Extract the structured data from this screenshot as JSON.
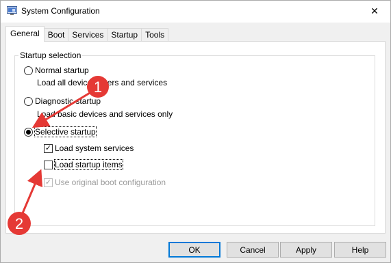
{
  "window": {
    "title": "System Configuration",
    "close_symbol": "✕"
  },
  "tabs": [
    {
      "label": "General",
      "active": true
    },
    {
      "label": "Boot",
      "active": false
    },
    {
      "label": "Services",
      "active": false
    },
    {
      "label": "Startup",
      "active": false
    },
    {
      "label": "Tools",
      "active": false
    }
  ],
  "startup_selection": {
    "legend": "Startup selection",
    "normal": {
      "label": "Normal startup",
      "description": "Load all device drivers and services",
      "selected": false
    },
    "diagnostic": {
      "label": "Diagnostic startup",
      "description": "Load basic devices and services only",
      "selected": false
    },
    "selective": {
      "label": "Selective startup",
      "selected": true,
      "options": {
        "system_services": {
          "label": "Load system services",
          "checked": true,
          "enabled": true
        },
        "startup_items": {
          "label": "Load startup items",
          "checked": false,
          "enabled": true
        },
        "original_boot": {
          "label": "Use original boot configuration",
          "checked": true,
          "enabled": false
        }
      }
    }
  },
  "buttons": {
    "ok": "OK",
    "cancel": "Cancel",
    "apply": "Apply",
    "help": "Help"
  },
  "annotations": {
    "badge_1": "1",
    "badge_2": "2",
    "color": "#e53935"
  },
  "colors": {
    "window_bg": "#f0f0f0",
    "panel_bg": "#ffffff",
    "focus_border": "#0078d7"
  }
}
